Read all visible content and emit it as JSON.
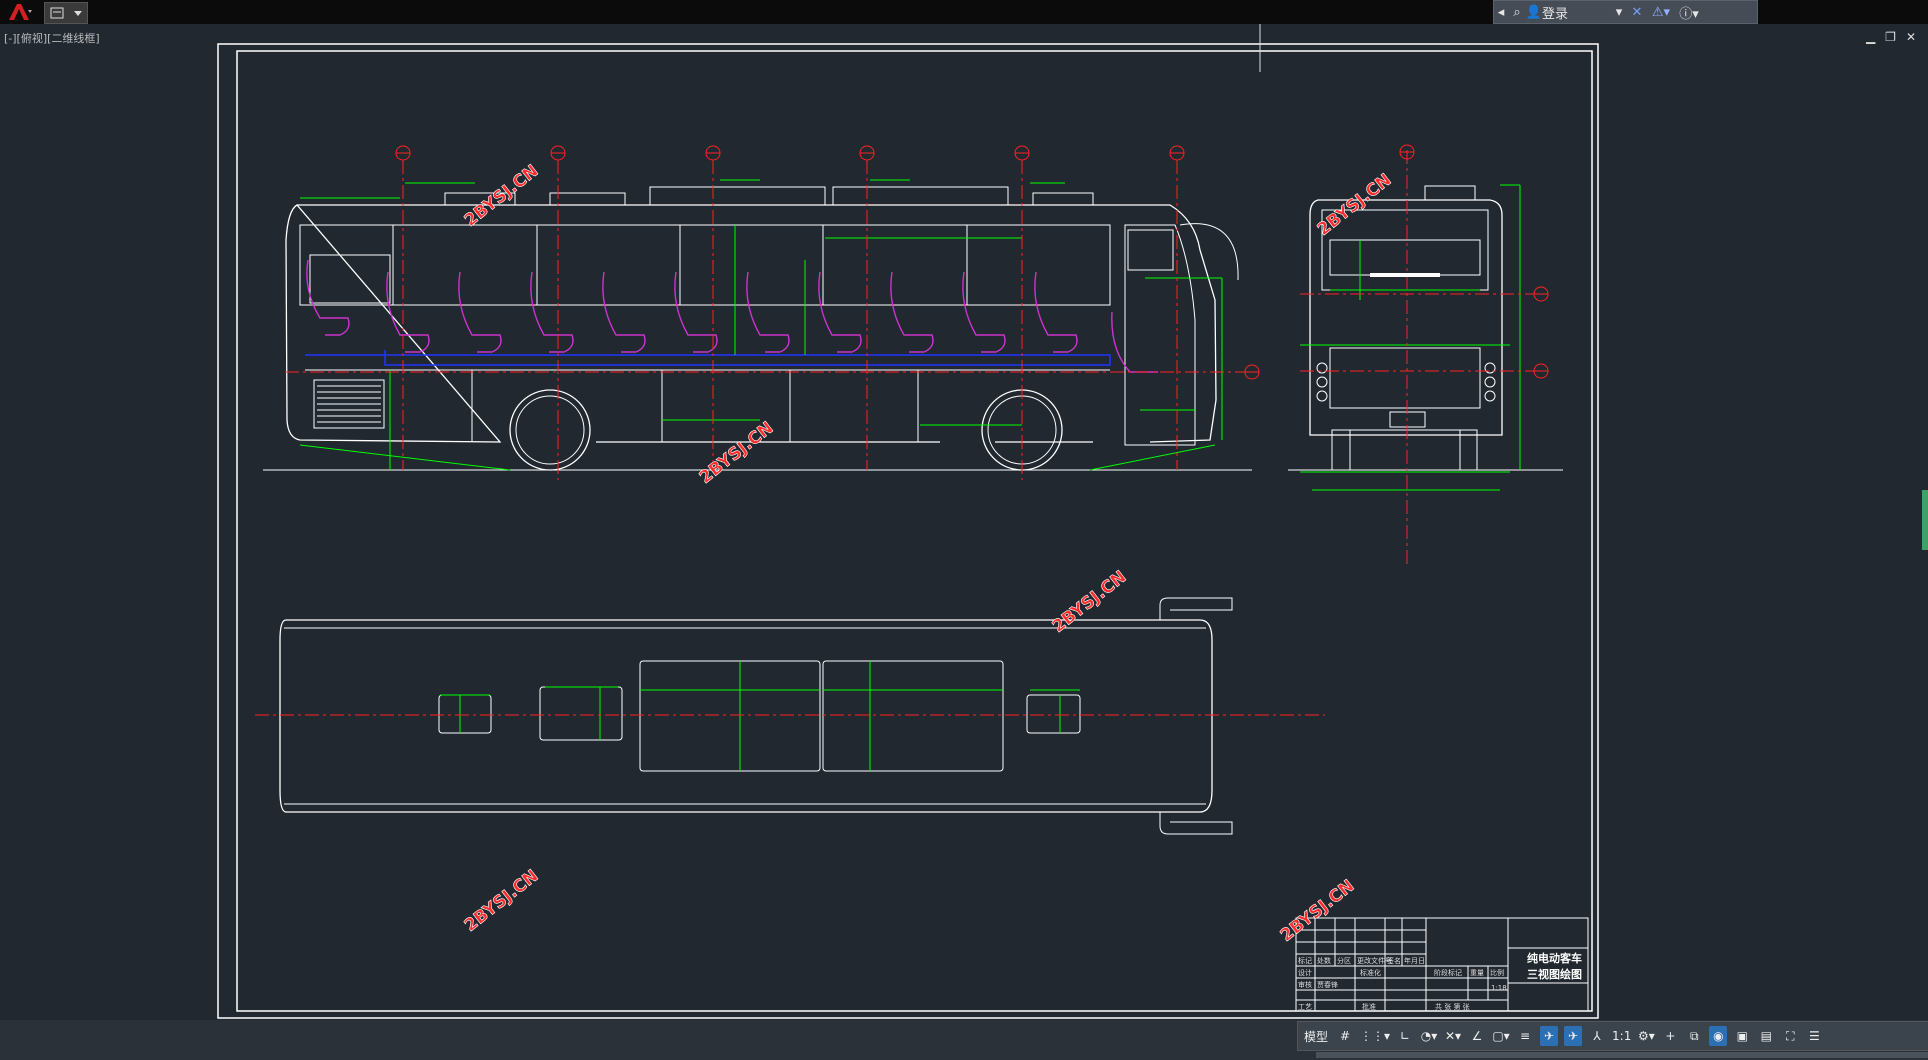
{
  "app": {
    "view_label": "[-][俯视][二维线框]",
    "login_label": "登录",
    "model_tab": "模型",
    "scale": "1:1"
  },
  "watermarks": [
    "2BYSJ.CN",
    "2BYSJ.CN",
    "2BYSJ.CN",
    "2BYSJ.CN",
    "2BYSJ.CN",
    "2BYSJ.CN"
  ],
  "title_block": {
    "title_line1": "纯电动客车",
    "title_line2": "三视图绘图",
    "scale_value": "1:18",
    "cells": {
      "mark": "标记",
      "count": "处数",
      "zone": "分区",
      "change_no": "更改文件号",
      "sign": "签名",
      "date": "年月日",
      "design": "设计",
      "standard": "标准化",
      "stage_mark": "阶段标记",
      "weight": "重量",
      "ratio": "比例",
      "review": "审核",
      "process": "工艺",
      "approve": "批准",
      "sheets": "共 张 第 张",
      "name_cell": "贾春锋"
    }
  },
  "colors": {
    "background": "#212830",
    "outline": "#ffffff",
    "dimension": "#00ff00",
    "centerline": "#ff2222",
    "seats": "#cc33cc",
    "floor": "#2233ff",
    "watermark": "#ff2a2a"
  },
  "icons": [
    "autocad-logo-icon",
    "qat-icon",
    "binoculars-icon",
    "user-icon",
    "x-icon",
    "exchange-icon",
    "help-icon",
    "minimize-icon",
    "restore-icon",
    "close-icon",
    "grid-icon",
    "snap-icon",
    "ortho-icon",
    "polar-icon",
    "osnap-icon",
    "lineweight-icon",
    "annotation-icon",
    "gear-icon",
    "plus-icon",
    "workspace-icon",
    "isolate-icon",
    "hardware-icon",
    "fullscreen-icon",
    "menu-icon"
  ]
}
